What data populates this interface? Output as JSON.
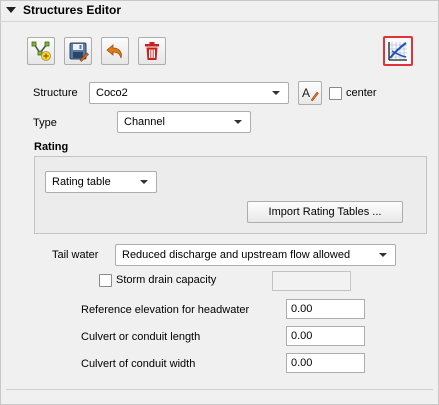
{
  "panel": {
    "title": "Structures Editor"
  },
  "toolbar": {
    "icons": [
      "add-structure-icon",
      "save-icon",
      "undo-icon",
      "delete-icon",
      "rating-curve-icon"
    ]
  },
  "structure": {
    "label": "Structure",
    "value": "Coco2",
    "center_label": "center"
  },
  "type": {
    "label": "Type",
    "value": "Channel"
  },
  "rating": {
    "title": "Rating",
    "value": "Rating table",
    "import_button": "Import Rating Tables ..."
  },
  "tail_water": {
    "label": "Tail water",
    "value": "Reduced discharge and upstream flow allowed"
  },
  "storm_drain": {
    "label": "Storm drain capacity",
    "value": ""
  },
  "fields": [
    {
      "label": "Reference elevation for headwater",
      "value": "0.00"
    },
    {
      "label": "Culvert or conduit length",
      "value": "0.00"
    },
    {
      "label": "Culvert of conduit width",
      "value": "0.00"
    }
  ],
  "colors": {
    "accent": "#e0343a",
    "red": "#c8201e",
    "orange": "#d96a1a",
    "blue": "#1f4fb8"
  }
}
